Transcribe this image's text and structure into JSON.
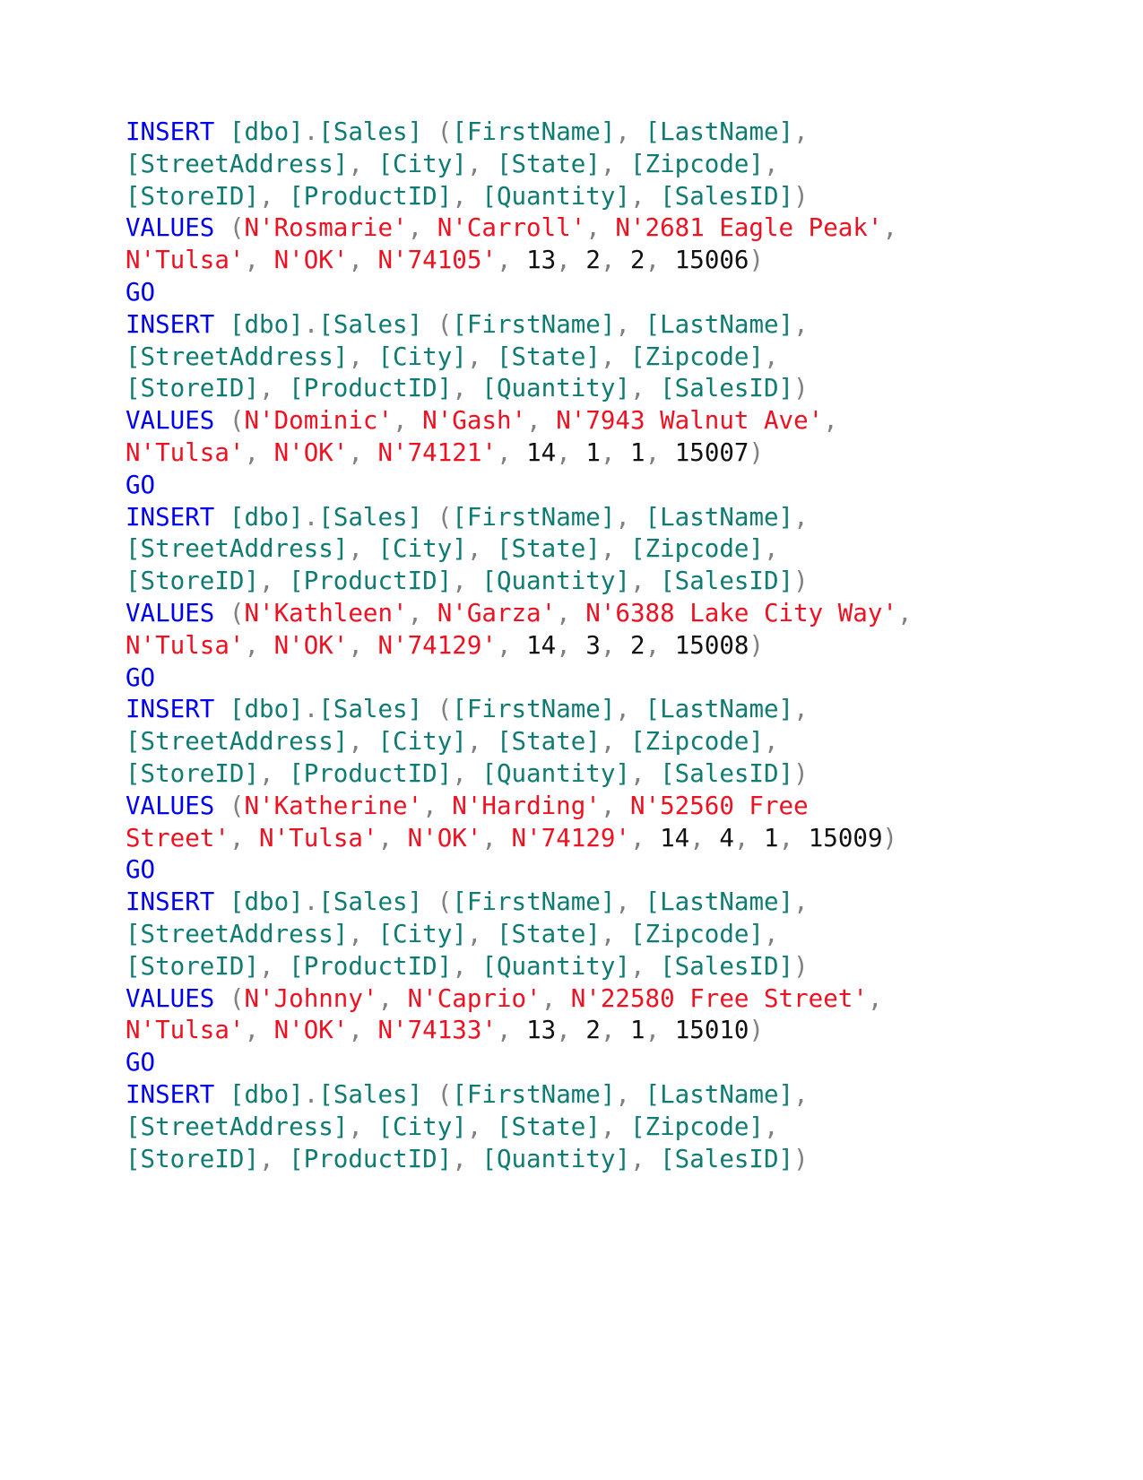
{
  "document": {
    "kind": "sql-script",
    "language": "T-SQL",
    "background_color": "#ffffff",
    "syntax_colors": {
      "keyword": "#0000f0",
      "identifier": "#0e7c72",
      "string": "#ee1122",
      "number": "#111111",
      "punctuation": "#808080"
    },
    "table": "[dbo].[Sales]",
    "columns": [
      "[FirstName]",
      "[LastName]",
      "[StreetAddress]",
      "[City]",
      "[State]",
      "[Zipcode]",
      "[StoreID]",
      "[ProductID]",
      "[Quantity]",
      "[SalesID]"
    ],
    "tokens": {
      "insert": "INSERT",
      "values": "VALUES",
      "go": "GO",
      "open_paren": "(",
      "close_paren": ")",
      "comma_space": ", ",
      "dot": ".",
      "space": " "
    },
    "statements": [
      {
        "first_name": "N'Rosmarie'",
        "last_name": "N'Carroll'",
        "street_address": "N'2681 Eagle Peak'",
        "city": "N'Tulsa'",
        "state": "N'OK'",
        "zipcode": "N'74105'",
        "store_id": "13",
        "product_id": "2",
        "quantity": "2",
        "sales_id": "15006",
        "terminator": "GO",
        "complete": true
      },
      {
        "first_name": "N'Dominic'",
        "last_name": "N'Gash'",
        "street_address": "N'7943 Walnut Ave'",
        "city": "N'Tulsa'",
        "state": "N'OK'",
        "zipcode": "N'74121'",
        "store_id": "14",
        "product_id": "1",
        "quantity": "1",
        "sales_id": "15007",
        "terminator": "GO",
        "complete": true
      },
      {
        "first_name": "N'Kathleen'",
        "last_name": "N'Garza'",
        "street_address": "N'6388 Lake City Way'",
        "city": "N'Tulsa'",
        "state": "N'OK'",
        "zipcode": "N'74129'",
        "store_id": "14",
        "product_id": "3",
        "quantity": "2",
        "sales_id": "15008",
        "terminator": "GO",
        "complete": true
      },
      {
        "first_name": "N'Katherine'",
        "last_name": "N'Harding'",
        "street_address": "N'52560 Free Street'",
        "city": "N'Tulsa'",
        "state": "N'OK'",
        "zipcode": "N'74129'",
        "store_id": "14",
        "product_id": "4",
        "quantity": "1",
        "sales_id": "15009",
        "terminator": "GO",
        "complete": true
      },
      {
        "first_name": "N'Johnny'",
        "last_name": "N'Caprio'",
        "street_address": "N'22580 Free Street'",
        "city": "N'Tulsa'",
        "state": "N'OK'",
        "zipcode": "N'74133'",
        "store_id": "13",
        "product_id": "2",
        "quantity": "1",
        "sales_id": "15010",
        "terminator": "GO",
        "complete": true
      },
      {
        "first_name": null,
        "last_name": null,
        "street_address": null,
        "city": null,
        "state": null,
        "zipcode": null,
        "store_id": null,
        "product_id": null,
        "quantity": null,
        "sales_id": null,
        "terminator": null,
        "complete": false
      }
    ]
  }
}
